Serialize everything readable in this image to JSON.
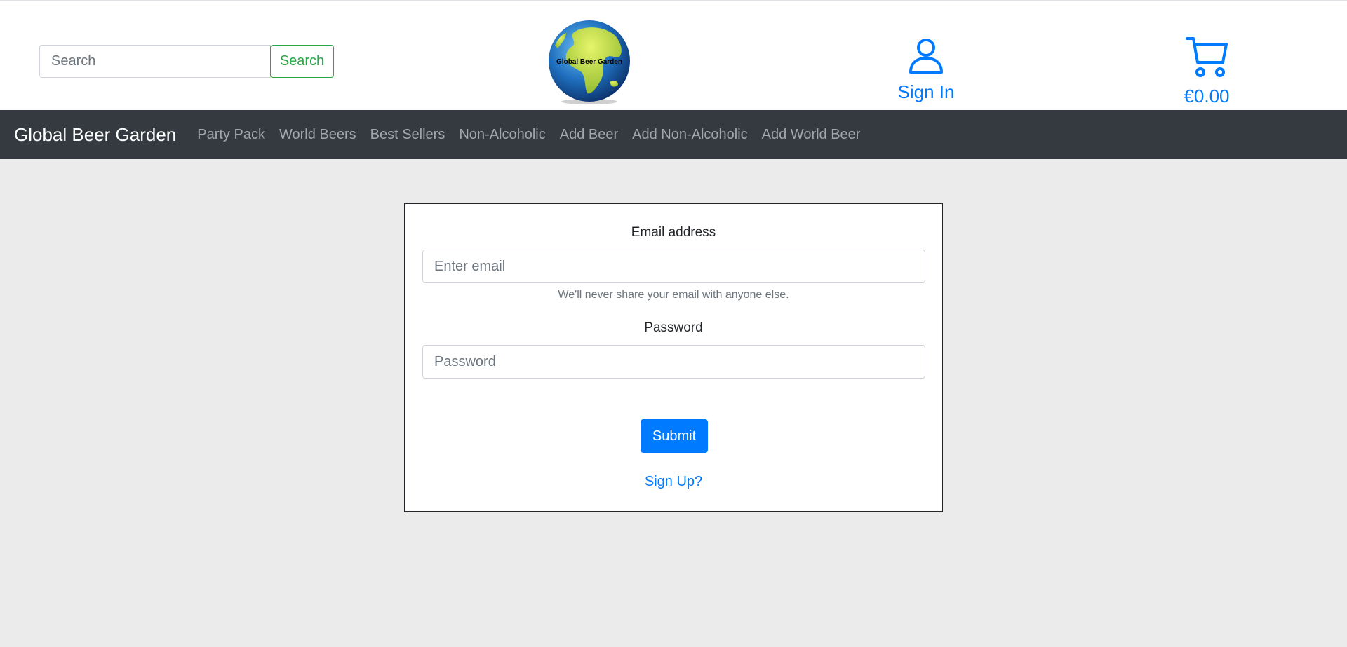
{
  "header": {
    "search_placeholder": "Search",
    "search_button": "Search",
    "logo_text": "Global Beer Garden",
    "signin_label": "Sign In",
    "cart_total": "€0.00"
  },
  "navbar": {
    "brand": "Global Beer Garden",
    "links": [
      "Party Pack",
      "World Beers",
      "Best Sellers",
      "Non-Alcoholic",
      "Add Beer",
      "Add Non-Alcoholic",
      "Add World Beer"
    ]
  },
  "login_form": {
    "email_label": "Email address",
    "email_placeholder": "Enter email",
    "email_help": "We'll never share your email with anyone else.",
    "password_label": "Password",
    "password_placeholder": "Password",
    "submit_label": "Submit",
    "signup_link": "Sign Up?"
  },
  "colors": {
    "primary": "#007bff",
    "success": "#28a745",
    "navbar_bg": "#343a40",
    "page_bg": "#ebebeb"
  }
}
